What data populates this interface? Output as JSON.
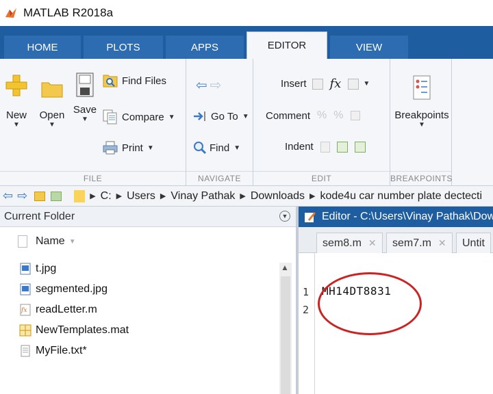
{
  "app": {
    "title": "MATLAB R2018a"
  },
  "tabs": [
    {
      "label": "HOME"
    },
    {
      "label": "PLOTS"
    },
    {
      "label": "APPS"
    },
    {
      "label": "EDITOR"
    },
    {
      "label": "VIEW"
    }
  ],
  "ribbon": {
    "file": {
      "label": "FILE",
      "new": "New",
      "open": "Open",
      "save": "Save",
      "find_files": "Find Files",
      "compare": "Compare",
      "print": "Print"
    },
    "navigate": {
      "label": "NAVIGATE",
      "go_to": "Go To",
      "find": "Find"
    },
    "edit": {
      "label": "EDIT",
      "insert": "Insert",
      "comment": "Comment",
      "indent": "Indent",
      "fx": "fx"
    },
    "breakpoints": {
      "label": "BREAKPOINTS",
      "button": "Breakpoints"
    }
  },
  "address": {
    "crumbs": [
      "C:",
      "Users",
      "Vinay Pathak",
      "Downloads",
      "kode4u car number plate dectecti"
    ]
  },
  "current_folder": {
    "title": "Current Folder",
    "name_column": "Name",
    "files": [
      {
        "name": "t.jpg",
        "icon": "image-file-icon"
      },
      {
        "name": "segmented.jpg",
        "icon": "image-file-icon"
      },
      {
        "name": "readLetter.m",
        "icon": "function-file-icon"
      },
      {
        "name": "NewTemplates.mat",
        "icon": "mat-file-icon"
      },
      {
        "name": "MyFile.txt*",
        "icon": "text-file-icon"
      }
    ]
  },
  "editor": {
    "title": "Editor - C:\\Users\\Vinay Pathak\\Downl",
    "tabs": [
      "sem8.m",
      "sem7.m",
      "Untit"
    ],
    "lines": [
      "MH14DT8831",
      ""
    ],
    "line_numbers": [
      "1",
      "2"
    ]
  },
  "colors": {
    "tab_strip": "#1f5da1",
    "editor_header": "#1f5da1",
    "annotation": "#cc2222"
  }
}
